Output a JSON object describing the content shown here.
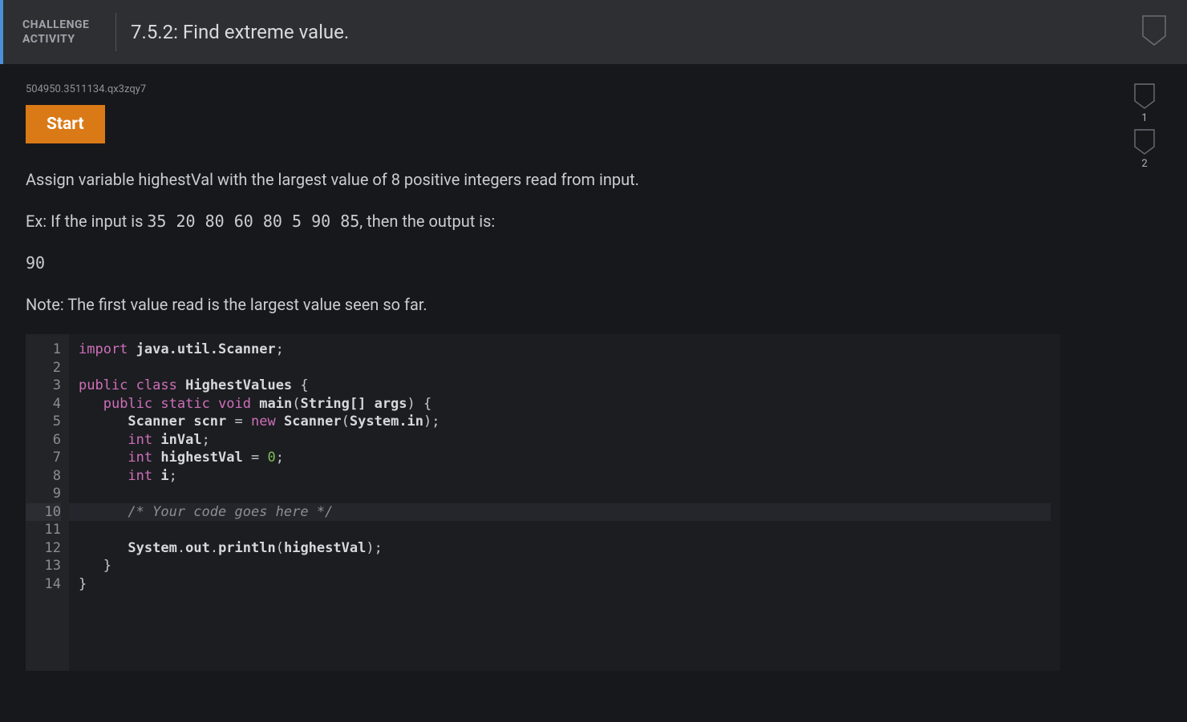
{
  "header": {
    "badge_line1": "CHALLENGE",
    "badge_line2": "ACTIVITY",
    "title": "7.5.2: Find extreme value."
  },
  "hash": "504950.3511134.qx3zqy7",
  "buttons": {
    "start": "Start"
  },
  "instructions": {
    "p1": "Assign variable highestVal with the largest value of 8 positive integers read from input.",
    "p2_a": "Ex: If the input is ",
    "p2_code": "35 20 80 60 80 5 90 85",
    "p2_b": ", then the output is:",
    "p3_code": "90",
    "p4": "Note: The first value read is the largest value seen so far."
  },
  "rail": {
    "step1": "1",
    "step2": "2"
  },
  "code": {
    "lines": [
      "1",
      "2",
      "3",
      "4",
      "5",
      "6",
      "7",
      "8",
      "9",
      "10",
      "11",
      "12",
      "13",
      "14"
    ],
    "active_line": "10",
    "l1_kw": "import",
    "l1_pkg": "java.util.Scanner",
    "l3_kw1": "public",
    "l3_kw2": "class",
    "l3_cls": "HighestValues",
    "l4_kw1": "public",
    "l4_kw2": "static",
    "l4_kw3": "void",
    "l4_mth": "main",
    "l4_arg": "String[] args",
    "l5_cls": "Scanner",
    "l5_id": "scnr",
    "l5_kw": "new",
    "l5_ctor": "Scanner",
    "l5_sysin": "System.in",
    "l6_kw": "int",
    "l6_id": "inVal",
    "l7_kw": "int",
    "l7_id": "highestVal",
    "l7_num": "0",
    "l8_kw": "int",
    "l8_id": "i",
    "l10_cmt": "/* Your code goes here */",
    "l12_sys": "System",
    "l12_out": "out",
    "l12_mth": "println",
    "l12_arg": "highestVal"
  }
}
